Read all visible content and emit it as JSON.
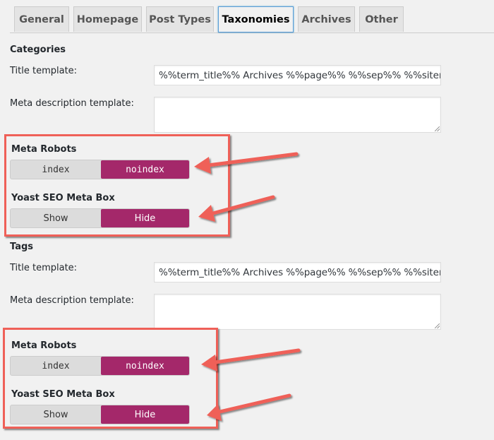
{
  "tabs": [
    {
      "label": "General",
      "active": false
    },
    {
      "label": "Homepage",
      "active": false
    },
    {
      "label": "Post Types",
      "active": false
    },
    {
      "label": "Taxonomies",
      "active": true
    },
    {
      "label": "Archives",
      "active": false
    },
    {
      "label": "Other",
      "active": false
    }
  ],
  "categories": {
    "title": "Categories",
    "title_template_label": "Title template:",
    "title_template_value": "%%term_title%% Archives %%page%% %%sep%% %%sitena",
    "meta_description_label": "Meta description template:",
    "meta_description_value": "",
    "meta_robots_label": "Meta Robots",
    "meta_robots_options": [
      "index",
      "noindex"
    ],
    "meta_robots_selected": "noindex",
    "metabox_label": "Yoast SEO Meta Box",
    "metabox_options": [
      "Show",
      "Hide"
    ],
    "metabox_selected": "Hide"
  },
  "tags": {
    "title": "Tags",
    "title_template_label": "Title template:",
    "title_template_value": "%%term_title%% Archives %%page%% %%sep%% %%sitena",
    "meta_description_label": "Meta description template:",
    "meta_description_value": "",
    "meta_robots_label": "Meta Robots",
    "meta_robots_options": [
      "index",
      "noindex"
    ],
    "meta_robots_selected": "noindex",
    "metabox_label": "Yoast SEO Meta Box",
    "metabox_options": [
      "Show",
      "Hide"
    ],
    "metabox_selected": "Hide"
  },
  "colors": {
    "accent_toggle": "#a4286a",
    "annotation_red": "#ef6058",
    "active_tab_border": "#5b9dd9"
  }
}
